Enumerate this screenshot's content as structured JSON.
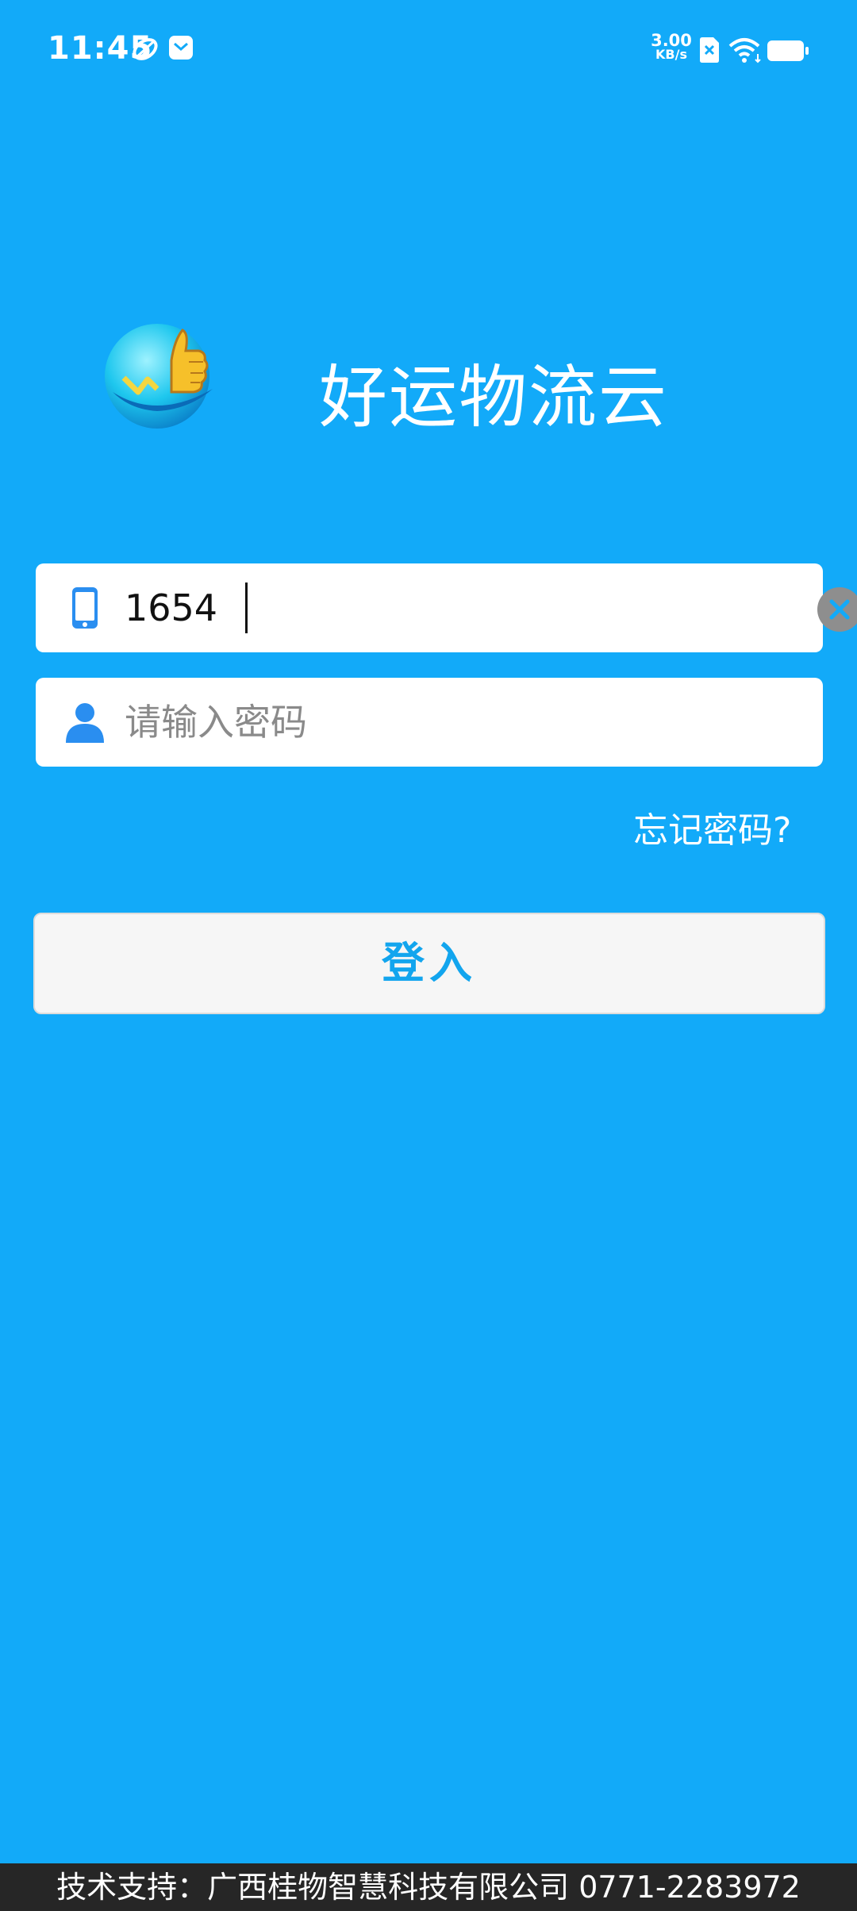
{
  "status_bar": {
    "time": "11:45",
    "net_speed_value": "3.00",
    "net_speed_unit": "KB/s"
  },
  "app": {
    "title": "好运物流云"
  },
  "login_form": {
    "phone_value": "1654",
    "password_placeholder": "请输入密码",
    "forgot_password": "忘记密码?",
    "login_label": "登入"
  },
  "footer": {
    "text": "技术支持：广西桂物智慧科技有限公司 0771-2283972"
  },
  "colors": {
    "background": "#12aaf9",
    "accent": "#12a5ee",
    "footer_bg": "#262626"
  }
}
